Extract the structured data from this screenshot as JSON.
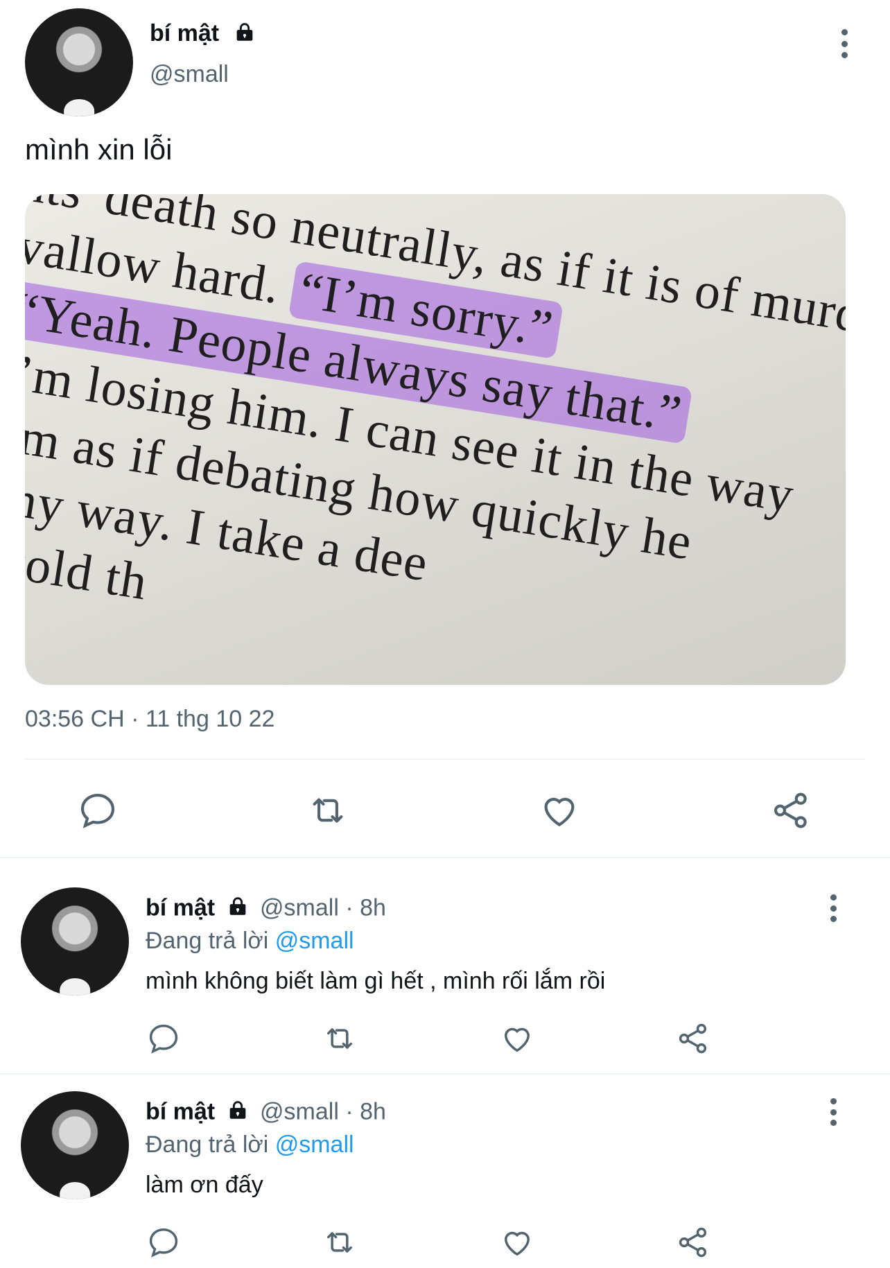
{
  "main_post": {
    "display_name": "bí mật",
    "handle": "@small",
    "text": "mình xin lỗi",
    "timestamp": "03:56 CH · 11 thg 10 22",
    "media_text_lines": [
      "nts' death so neutrally, as if it is of murders, e",
      "vallow hard. “I’m sorry.”",
      "“Yeah. People always say that.”",
      "I’m losing him. I can see it in the way",
      "oom as if debating how quickly he",
      "n my way. I take a dee",
      "he told th"
    ]
  },
  "replies": [
    {
      "display_name": "bí mật",
      "handle": "@small",
      "time": "· 8h",
      "replying_prefix": "Đang trả lời",
      "replying_to": "@small",
      "text": "mình không biết làm gì hết , mình rối lắm rồi"
    },
    {
      "display_name": "bí mật",
      "handle": "@small",
      "time": "· 8h",
      "replying_prefix": "Đang trả lời",
      "replying_to": "@small",
      "text": "làm ơn đấy"
    }
  ],
  "icons": {
    "reply": "reply-icon",
    "retweet": "retweet-icon",
    "like": "like-icon",
    "share": "share-icon",
    "more": "more-options-icon",
    "lock": "lock-icon"
  },
  "colors": {
    "link": "#1d9bf0",
    "muted": "#536471",
    "highlight": "#b07be0"
  }
}
